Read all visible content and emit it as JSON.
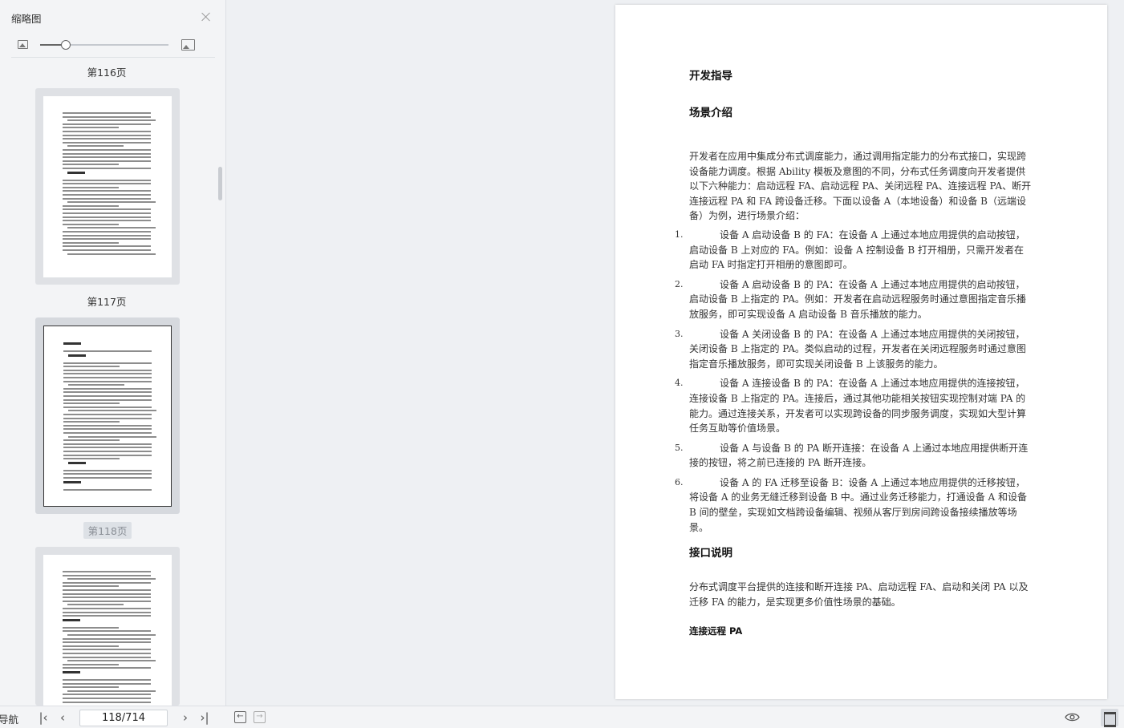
{
  "sidebar": {
    "title": "缩略图",
    "zoom_level": 0.2,
    "thumbnails": [
      {
        "label": "第116页",
        "active": false
      },
      {
        "label": "第117页",
        "active": false
      },
      {
        "label": "第118页",
        "active": true
      },
      {
        "label": "",
        "active": false
      }
    ]
  },
  "document": {
    "heading": "开发指导",
    "section1": "场景介绍",
    "intro": "开发者在应用中集成分布式调度能力，通过调用指定能力的分布式接口，实现跨设备能力调度。根据 Ability 模板及意图的不同，分布式任务调度向开发者提供以下六种能力：启动远程 FA、启动远程 PA、关闭远程 PA、连接远程 PA、断开连接远程 PA 和 FA 跨设备迁移。下面以设备 A（本地设备）和设备 B（远端设备）为例，进行场景介绍：",
    "items": [
      {
        "num": "1.",
        "text": "设备 A 启动设备 B 的 FA：在设备 A 上通过本地应用提供的启动按钮，启动设备 B 上对应的 FA。例如：设备 A 控制设备 B 打开相册，只需开发者在启动 FA 时指定打开相册的意图即可。"
      },
      {
        "num": "2.",
        "text": "设备 A 启动设备 B 的 PA：在设备 A 上通过本地应用提供的启动按钮，启动设备 B 上指定的 PA。例如：开发者在启动远程服务时通过意图指定音乐播放服务，即可实现设备 A 启动设备 B 音乐播放的能力。"
      },
      {
        "num": "3.",
        "text": "设备 A 关闭设备 B 的 PA：在设备 A 上通过本地应用提供的关闭按钮，关闭设备 B 上指定的 PA。类似启动的过程，开发者在关闭远程服务时通过意图指定音乐播放服务，即可实现关闭设备 B 上该服务的能力。"
      },
      {
        "num": "4.",
        "text": "设备 A 连接设备 B 的 PA：在设备 A 上通过本地应用提供的连接按钮，连接设备 B 上指定的 PA。连接后，通过其他功能相关按钮实现控制对端 PA 的能力。通过连接关系，开发者可以实现跨设备的同步服务调度，实现如大型计算任务互助等价值场景。"
      },
      {
        "num": "5.",
        "text": "设备 A 与设备 B 的 PA 断开连接：在设备 A 上通过本地应用提供断开连接的按钮，将之前已连接的 PA 断开连接。"
      },
      {
        "num": "6.",
        "text": "设备 A 的 FA 迁移至设备 B：设备 A 上通过本地应用提供的迁移按钮，将设备 A 的业务无缝迁移到设备 B 中。通过业务迁移能力，打通设备 A 和设备 B 间的壁垒，实现如文档跨设备编辑、视频从客厅到房间跨设备接续播放等场景。"
      }
    ],
    "section2": "接口说明",
    "section2_text": "分布式调度平台提供的连接和断开连接 PA、启动远程 FA、启动和关闭 PA 以及迁移 FA 的能力，是实现更多价值性场景的基础。",
    "section3": "连接远程 PA"
  },
  "bottombar": {
    "nav_label": "导航",
    "page_indicator": "118/714"
  }
}
